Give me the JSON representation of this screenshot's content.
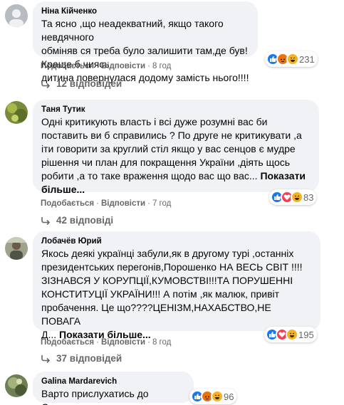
{
  "colors": {
    "like": "#1877f2",
    "love": "#f33e58",
    "angry": "#e9710f",
    "haha": "#f7b125",
    "secondary_text": "#65676b",
    "bubble_bg": "#f0f2f5"
  },
  "comments": [
    {
      "author": "Ніна Кійченко",
      "text": "Та ясно ,що неадекватний, якщо такого невдячного\nобміняв ся треба було залишити там,де був!Краще б чиясь\nдитина повернулася додому замість нього!!!!",
      "more": "",
      "like_label": "Подобається",
      "reply_label": "Відповісти",
      "time": "8 год",
      "reactions": [
        "like-icon",
        "angry-icon",
        "haha-icon"
      ],
      "reaction_count": "231",
      "replies_label": "12 відповідей"
    },
    {
      "author": "Таня Тутик",
      "text": "Одні критикують власть і всі дуже розумні вас би\nпоставить ви б справились ? По друге не критикувати ,а\nіти говорити за круглий стіл якщо у вас сенцов є мудре\nрішення чи план для покращення України ,діять щось\nробити ,а то таке враження щодо вас що вас... ",
      "more": "Показати\nбільше...",
      "like_label": "Подобається",
      "reply_label": "Відповісти",
      "time": "7 год",
      "reactions": [
        "like-icon",
        "love-icon",
        "haha-icon"
      ],
      "reaction_count": "83",
      "replies_label": "42 відповіді"
    },
    {
      "author": "Лобачёв Юрий",
      "text": "Якось деякі українці забули,як в другому турі ,останніх\nпрезидентських перегонів,Порошенко НА ВЕСЬ СВІТ !!!!\nЗІЗНАВСЯ У КОРУПЦІЇ,КУМОВСТВІ!!!ТА ПОРУШЕННІ\nКОНСТИТУЦІЇ УКРАЇНИ!!! А потім ,як малюк, привіт\nпробачення. Це що????ЦЕНІЗМ,НАХАБСТВО,НЕ ПОВАГА\nД... ",
      "more": "Показати більше...",
      "like_label": "Подобається",
      "reply_label": "Відповісти",
      "time": "8 год",
      "reactions": [
        "like-icon",
        "love-icon",
        "haha-icon"
      ],
      "reaction_count": "195",
      "replies_label": "37 відповідей"
    },
    {
      "author": "Galina Mardarevich",
      "text": "Варто прислухатись до Сєнцова",
      "more": "",
      "reactions": [
        "like-icon",
        "angry-icon",
        "haha-icon"
      ],
      "reaction_count": "96"
    }
  ]
}
